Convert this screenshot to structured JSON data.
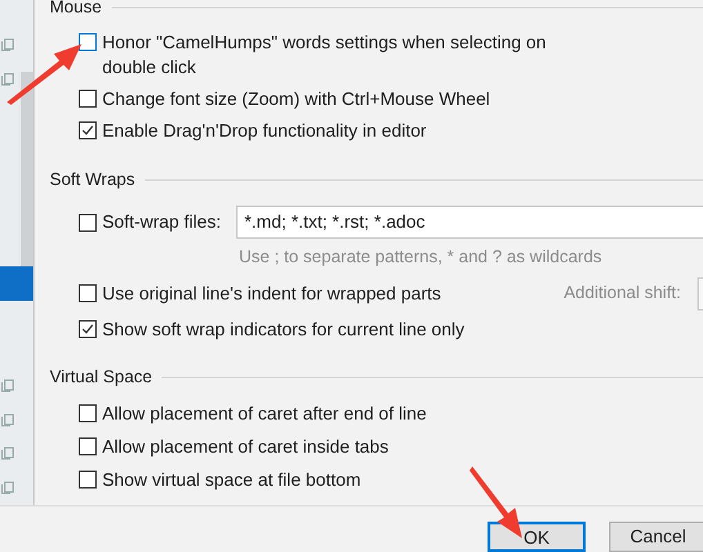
{
  "sidebar": {
    "items": [
      {
        "icon": true,
        "selected": false
      },
      {
        "icon": true,
        "selected": false
      },
      {
        "icon": false,
        "selected": false
      },
      {
        "icon": false,
        "selected": false
      },
      {
        "icon": false,
        "selected": false
      },
      {
        "icon": false,
        "selected": false
      },
      {
        "icon": false,
        "selected": false
      },
      {
        "icon": false,
        "selected": true
      },
      {
        "icon": false,
        "selected": false
      },
      {
        "icon": false,
        "selected": false
      },
      {
        "icon": true,
        "selected": false
      },
      {
        "icon": true,
        "selected": false
      },
      {
        "icon": true,
        "selected": false
      },
      {
        "icon": true,
        "selected": false
      }
    ]
  },
  "sections": [
    {
      "title": "Mouse",
      "rows": [
        {
          "kind": "checkbox",
          "label": "Honor \"CamelHumps\" words settings when selecting on double click",
          "checked": false,
          "focused": true
        },
        {
          "kind": "checkbox",
          "label": "Change font size (Zoom) with Ctrl+Mouse Wheel",
          "checked": false,
          "focused": false
        },
        {
          "kind": "checkbox",
          "label": "Enable Drag'n'Drop functionality in editor",
          "checked": true,
          "focused": false
        }
      ]
    },
    {
      "title": "Soft Wraps",
      "rows": [
        {
          "kind": "field",
          "label": "Soft-wrap files:",
          "checked": false,
          "focused": false,
          "value": "*.md; *.txt; *.rst; *.adoc",
          "hint": "Use ; to separate patterns, * and ? as wildcards"
        },
        {
          "kind": "shift",
          "label": "Use original line's indent for wrapped parts",
          "checked": false,
          "focused": false,
          "side_label": "Additional shift:"
        },
        {
          "kind": "checkbox",
          "label": "Show soft wrap indicators for current line only",
          "checked": true,
          "focused": false
        }
      ]
    },
    {
      "title": "Virtual Space",
      "rows": [
        {
          "kind": "checkbox",
          "label": "Allow placement of caret after end of line",
          "checked": false,
          "focused": false
        },
        {
          "kind": "checkbox",
          "label": "Allow placement of caret inside tabs",
          "checked": false,
          "focused": false
        },
        {
          "kind": "checkbox",
          "label": "Show virtual space at file bottom",
          "checked": false,
          "focused": false
        }
      ]
    }
  ],
  "buttons": [
    {
      "label": "OK",
      "default": true
    },
    {
      "label": "Cancel",
      "default": false
    }
  ]
}
